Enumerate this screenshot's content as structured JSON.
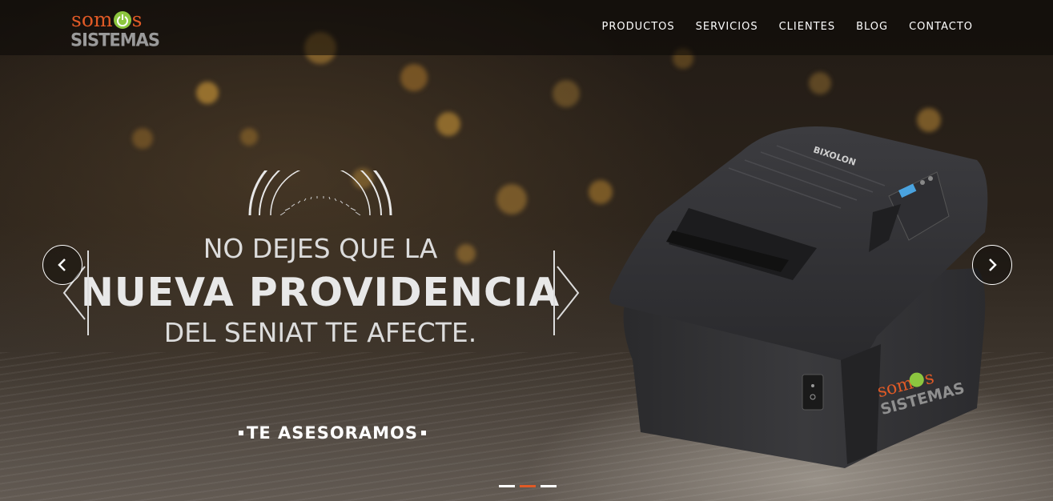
{
  "header": {
    "logo": {
      "top": "som",
      "top_tail": "s",
      "bottom": "SISTEMAS"
    },
    "nav": [
      "PRODUCTOS",
      "SERVICIOS",
      "CLIENTES",
      "BLOG",
      "CONTACTO"
    ]
  },
  "slide": {
    "line1": "NO DEJES QUE LA",
    "line2": "NUEVA PROVIDENCIA",
    "line3": "DEL SENIAT TE AFECTE.",
    "cta": "TE ASESORAMOS",
    "printer_brand": "BIXOLON",
    "printer_logo_top": "som",
    "printer_logo_tail": "s",
    "printer_logo_bottom": "SISTEMAS"
  },
  "carousel": {
    "slide_count": 3,
    "active_index": 1,
    "prev_icon": "chevron-left-icon",
    "next_icon": "chevron-right-icon"
  },
  "colors": {
    "accent": "#e05a26",
    "power_green": "#8cc63f",
    "logo_gray": "#9a9a9a"
  }
}
